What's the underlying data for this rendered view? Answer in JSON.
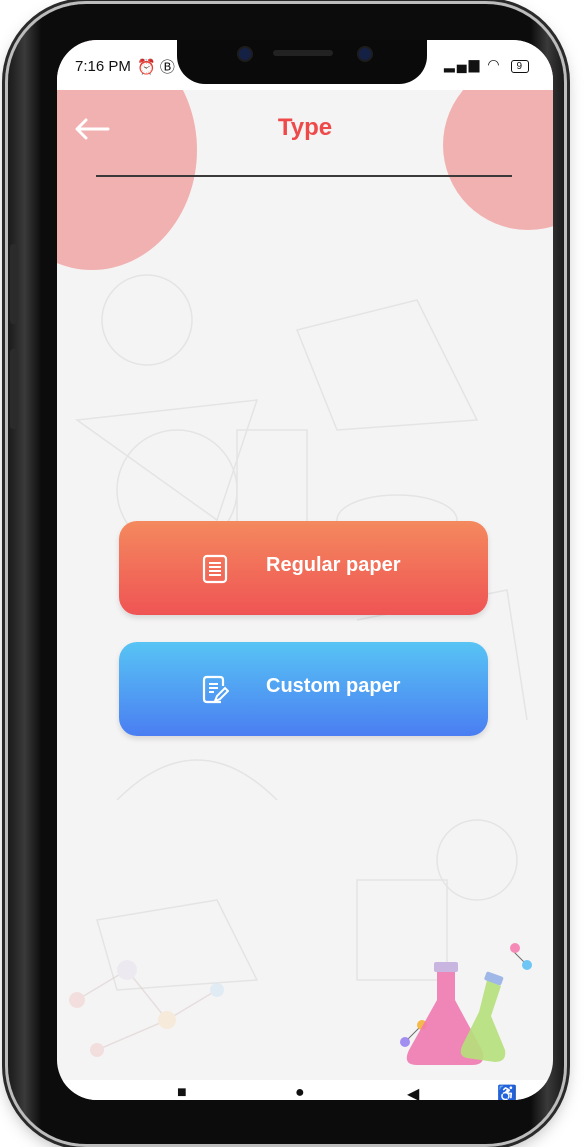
{
  "status_bar": {
    "time": "7:16 PM",
    "left_icons": "alarm-icon, b-icon",
    "battery_level": "9"
  },
  "header": {
    "back_icon": "arrow-left-icon",
    "title": "Type"
  },
  "buttons": [
    {
      "label": "Regular paper",
      "icon": "document-icon",
      "gradient": [
        "#f4895e",
        "#ef5454"
      ]
    },
    {
      "label": "Custom paper",
      "icon": "document-edit-icon",
      "gradient": [
        "#58c4f4",
        "#4a7ef2"
      ]
    }
  ],
  "colors": {
    "accent": "#ef4a4a",
    "blob": "#ef9b9b",
    "background": "#f5f4f4"
  },
  "nav": {
    "items": [
      "square-icon",
      "circle-icon",
      "triangle-back-icon",
      "accessibility-icon"
    ]
  }
}
